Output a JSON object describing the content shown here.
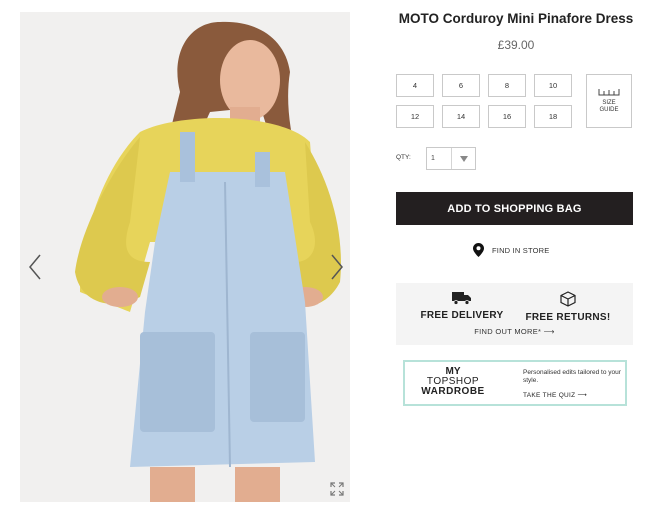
{
  "product": {
    "title": "MOTO Corduroy Mini Pinafore Dress",
    "price": "£39.00"
  },
  "gallery": {
    "prev_icon": "chevron-left-icon",
    "next_icon": "chevron-right-icon",
    "zoom_icon": "expand-icon"
  },
  "sizes": [
    "4",
    "6",
    "8",
    "10",
    "12",
    "14",
    "16",
    "18"
  ],
  "size_guide": {
    "label": "SIZE GUIDE",
    "icon": "ruler-icon"
  },
  "quantity": {
    "label": "QTY:",
    "value": "1"
  },
  "add_to_bag": {
    "label": "ADD TO SHOPPING BAG"
  },
  "find_in_store": {
    "label": "FIND IN STORE",
    "icon": "location-pin-icon"
  },
  "delivery": {
    "free_delivery": "FREE DELIVERY",
    "free_returns": "FREE RETURNS!",
    "find_out_more": "FIND OUT MORE* ⟶"
  },
  "wardrobe": {
    "line1": "MY",
    "line2": "TOPSHOP",
    "line3": "WARDROBE",
    "copy": "Personalised edits tailored to your style.",
    "cta": "TAKE THE QUIZ ⟶"
  },
  "colors": {
    "button_bg": "#231f20",
    "wardrobe_border": "#b7e2d9",
    "delivery_bg": "#f4f4f4"
  }
}
